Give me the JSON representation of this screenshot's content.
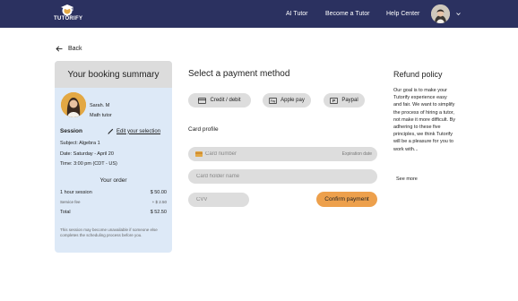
{
  "header": {
    "logo_text": "TUTORIFY",
    "nav": [
      "AI Tutor",
      "Become a Tutor",
      "Help Center"
    ],
    "icons": [
      "logo-icon",
      "avatar",
      "chevron-down-icon"
    ]
  },
  "back_label": "Back",
  "summary": {
    "title": "Your booking summary",
    "tutor_name": "Sarah. M",
    "tutor_subject": "Math tutor",
    "session_title": "Session",
    "edit_label": "Edit your selection",
    "subject_line": "Subject: Algebra 1",
    "date_line": "Date: Saturday - April 20",
    "time_line": "Time: 3:00 pm (CDT - US)",
    "order_title": "Your order",
    "rows": [
      {
        "label": "1 hour session",
        "value": "$ 50.00"
      },
      {
        "label": "Service fee",
        "value": "+ $ 2.50"
      },
      {
        "label": "Total",
        "value": "$ 52.50"
      }
    ],
    "note": "This session may become unavailable if someone else completes the scheduling process before you."
  },
  "payment": {
    "title": "Select a payment method",
    "methods": [
      "Credit / debit",
      "Apple pay",
      "Paypal"
    ],
    "card_profile_label": "Card profile",
    "card_number_placeholder": "Card number",
    "expiration_label": "Expiration date",
    "holder_placeholder": "Card holder name",
    "cvv_placeholder": "CVV",
    "confirm_label": "Confirm payment"
  },
  "refund": {
    "title": "Refund policy",
    "text": "Our goal is to make your Tutorify experience easy and fair. We want to simplify the process of hiring a tutor, not make it more difficult. By adhering to these five principles, we think Tutorify will be a pleasure for you to work with...",
    "see_more": "See more"
  },
  "colors": {
    "header_bg": "#2b3160",
    "summary_bg": "#dde9f7",
    "accent": "#eda04c"
  }
}
